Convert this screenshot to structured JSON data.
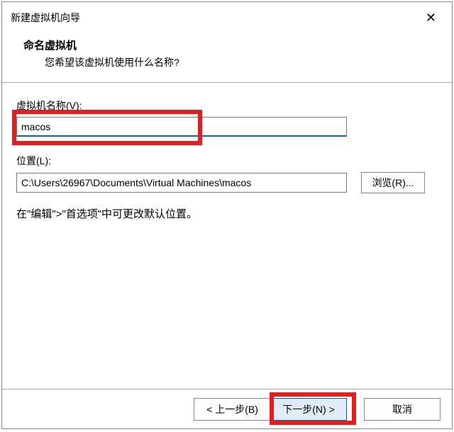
{
  "titlebar": {
    "title": "新建虚拟机向导"
  },
  "header": {
    "title": "命名虚拟机",
    "desc": "您希望该虚拟机使用什么名称?"
  },
  "fields": {
    "name_label": "虚拟机名称(V):",
    "name_value": "macos",
    "location_label": "位置(L):",
    "location_value": "C:\\Users\\26967\\Documents\\Virtual Machines\\macos",
    "browse_label": "浏览(R)..."
  },
  "hint": "在\"编辑\">\"首选项\"中可更改默认位置。",
  "footer": {
    "back": "< 上一步(B)",
    "next": "下一步(N) >",
    "cancel": "取消"
  }
}
